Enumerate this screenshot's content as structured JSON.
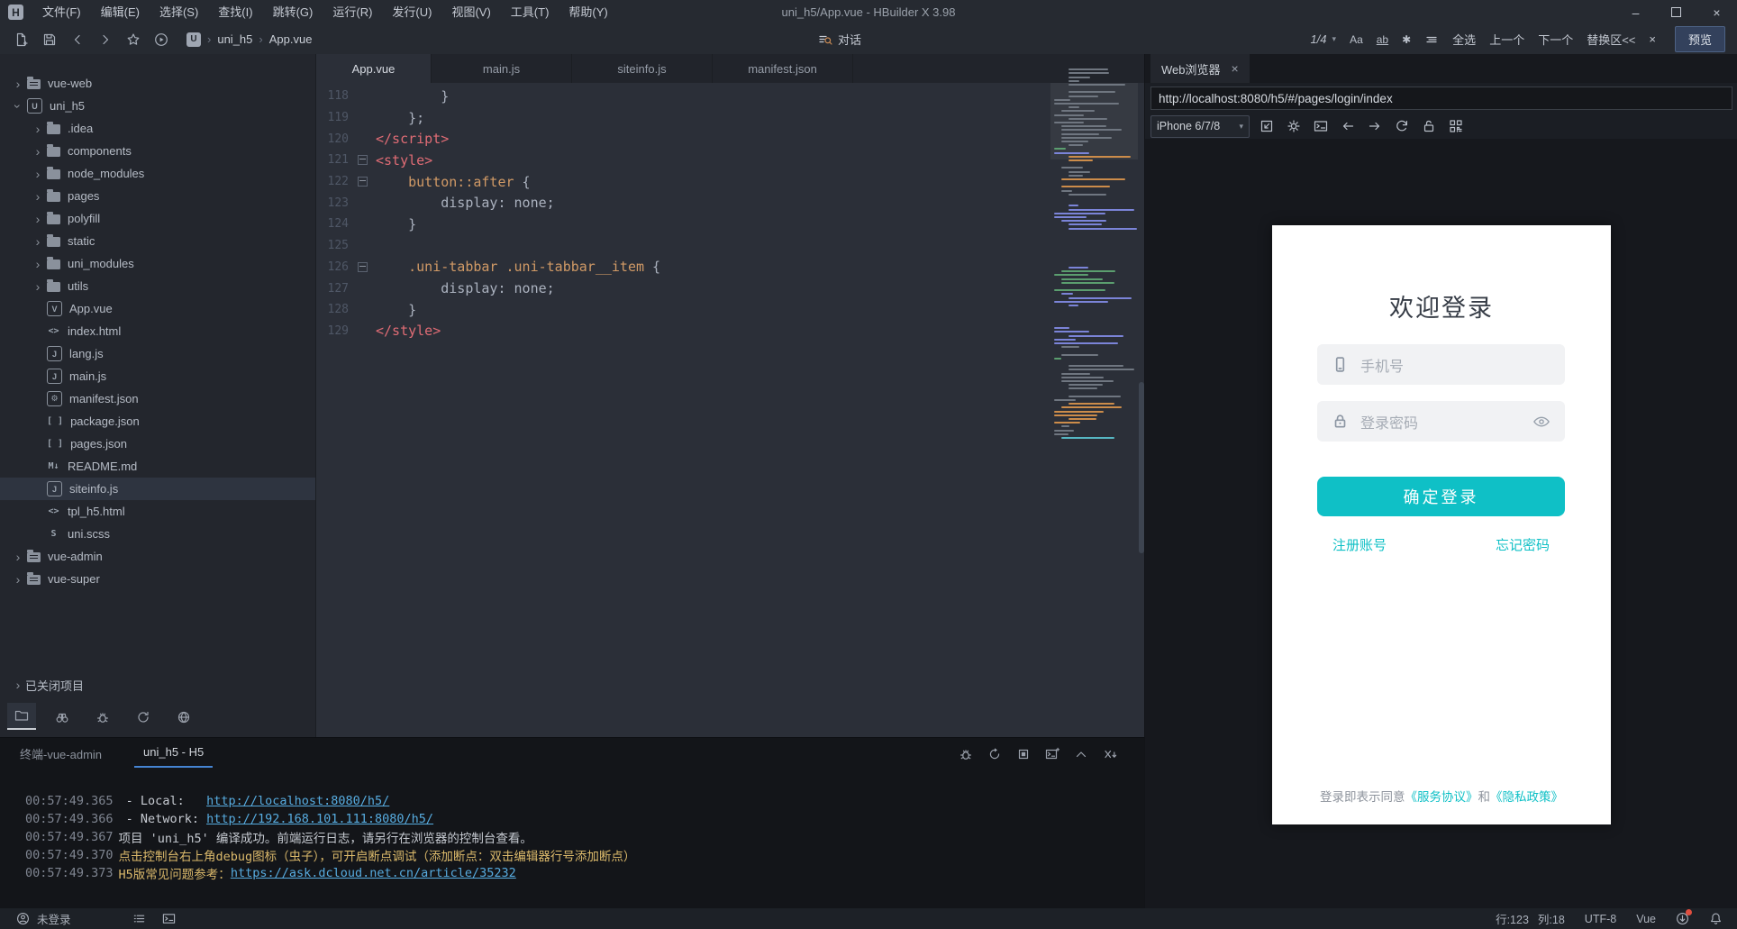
{
  "window": {
    "title": "uni_h5/App.vue - HBuilder X 3.98",
    "menus": [
      "文件(F)",
      "编辑(E)",
      "选择(S)",
      "查找(I)",
      "跳转(G)",
      "运行(R)",
      "发行(U)",
      "视图(V)",
      "工具(T)",
      "帮助(Y)"
    ]
  },
  "toolbar": {
    "breadcrumb": {
      "project": "uni_h5",
      "file": "App.vue"
    },
    "chat_label": "对话",
    "find": {
      "counter": "1/4",
      "select_all": "全选",
      "prev": "上一个",
      "next": "下一个",
      "replace": "替换区<<",
      "preview": "预览"
    }
  },
  "sidebar": {
    "closed_projects": "已关闭项目",
    "tree": [
      {
        "label": "vue-web",
        "depth": 0,
        "icon": "project-folder",
        "expand": "closed"
      },
      {
        "label": "uni_h5",
        "depth": 0,
        "icon": "uni",
        "expand": "open"
      },
      {
        "label": ".idea",
        "depth": 1,
        "icon": "folder",
        "expand": "closed"
      },
      {
        "label": "components",
        "depth": 1,
        "icon": "folder",
        "expand": "closed"
      },
      {
        "label": "node_modules",
        "depth": 1,
        "icon": "folder",
        "expand": "closed"
      },
      {
        "label": "pages",
        "depth": 1,
        "icon": "folder",
        "expand": "closed"
      },
      {
        "label": "polyfill",
        "depth": 1,
        "icon": "folder",
        "expand": "closed"
      },
      {
        "label": "static",
        "depth": 1,
        "icon": "folder",
        "expand": "closed"
      },
      {
        "label": "uni_modules",
        "depth": 1,
        "icon": "folder",
        "expand": "closed"
      },
      {
        "label": "utils",
        "depth": 1,
        "icon": "folder",
        "expand": "closed"
      },
      {
        "label": "App.vue",
        "depth": 1,
        "icon": "vue"
      },
      {
        "label": "index.html",
        "depth": 1,
        "icon": "html"
      },
      {
        "label": "lang.js",
        "depth": 1,
        "icon": "js"
      },
      {
        "label": "main.js",
        "depth": 1,
        "icon": "js"
      },
      {
        "label": "manifest.json",
        "depth": 1,
        "icon": "gearjson"
      },
      {
        "label": "package.json",
        "depth": 1,
        "icon": "json"
      },
      {
        "label": "pages.json",
        "depth": 1,
        "icon": "json"
      },
      {
        "label": "README.md",
        "depth": 1,
        "icon": "md"
      },
      {
        "label": "siteinfo.js",
        "depth": 1,
        "icon": "js",
        "selected": true
      },
      {
        "label": "tpl_h5.html",
        "depth": 1,
        "icon": "html"
      },
      {
        "label": "uni.scss",
        "depth": 1,
        "icon": "scss"
      },
      {
        "label": "vue-admin",
        "depth": 0,
        "icon": "project-folder",
        "expand": "closed"
      },
      {
        "label": "vue-super",
        "depth": 0,
        "icon": "project-folder",
        "expand": "closed"
      }
    ]
  },
  "editor": {
    "tabs": [
      {
        "label": "App.vue",
        "active": true
      },
      {
        "label": "main.js",
        "active": false
      },
      {
        "label": "siteinfo.js",
        "active": false
      },
      {
        "label": "manifest.json",
        "active": false
      }
    ],
    "code": [
      {
        "num": 118,
        "fold": false,
        "segments": [
          {
            "t": "        }",
            "c": "plain"
          }
        ]
      },
      {
        "num": 119,
        "fold": false,
        "segments": [
          {
            "t": "    };",
            "c": "plain"
          }
        ]
      },
      {
        "num": 120,
        "fold": false,
        "segments": [
          {
            "t": "</script>",
            "c": "tag"
          }
        ]
      },
      {
        "num": 121,
        "fold": true,
        "segments": [
          {
            "t": "<style>",
            "c": "tag"
          }
        ]
      },
      {
        "num": 122,
        "fold": true,
        "segments": [
          {
            "t": "    ",
            "c": "plain"
          },
          {
            "t": "button::after",
            "c": "sel"
          },
          {
            "t": " {",
            "c": "plain"
          }
        ]
      },
      {
        "num": 123,
        "fold": false,
        "segments": [
          {
            "t": "        display: none;",
            "c": "plain"
          }
        ]
      },
      {
        "num": 124,
        "fold": false,
        "segments": [
          {
            "t": "    }",
            "c": "plain"
          }
        ]
      },
      {
        "num": 125,
        "fold": false,
        "segments": []
      },
      {
        "num": 126,
        "fold": true,
        "segments": [
          {
            "t": "    ",
            "c": "plain"
          },
          {
            "t": ".uni-tabbar .uni-tabbar__item",
            "c": "sel"
          },
          {
            "t": " {",
            "c": "plain"
          }
        ]
      },
      {
        "num": 127,
        "fold": false,
        "segments": [
          {
            "t": "        display: none;",
            "c": "plain"
          }
        ]
      },
      {
        "num": 128,
        "fold": false,
        "segments": [
          {
            "t": "    }",
            "c": "plain"
          }
        ]
      },
      {
        "num": 129,
        "fold": false,
        "segments": [
          {
            "t": "</style>",
            "c": "tag"
          }
        ]
      }
    ]
  },
  "console": {
    "tabs": [
      {
        "label": "终端-vue-admin",
        "active": false
      },
      {
        "label": "uni_h5 - H5",
        "active": true
      }
    ],
    "lines": [
      {
        "time": "00:57:49.365",
        "segments": [
          {
            "t": " - Local:   ",
            "c": "plain"
          },
          {
            "t": "http://localhost:8080/h5/",
            "c": "link"
          }
        ]
      },
      {
        "time": "00:57:49.366",
        "segments": [
          {
            "t": " - Network: ",
            "c": "plain"
          },
          {
            "t": "http://192.168.101.111:8080/h5/",
            "c": "link"
          }
        ]
      },
      {
        "time": "00:57:49.367",
        "segments": [
          {
            "t": "项目 'uni_h5' 编译成功。前端运行日志，请另行在浏览器的控制台查看。",
            "c": "plain"
          }
        ]
      },
      {
        "time": "00:57:49.370",
        "segments": [
          {
            "t": "点击控制台右上角debug图标（虫子），可开启断点调试（添加断点：双击编辑器行号添加断点）",
            "c": "warn"
          }
        ]
      },
      {
        "time": "00:57:49.373",
        "segments": [
          {
            "t": "H5版常见问题参考：",
            "c": "warn"
          },
          {
            "t": "https://ask.dcloud.net.cn/article/35232",
            "c": "link"
          }
        ]
      }
    ]
  },
  "browser": {
    "tab_label": "Web浏览器",
    "url": "http://localhost:8080/h5/#/pages/login/index",
    "device": "iPhone 6/7/8",
    "accent": "#0fc0c6",
    "login": {
      "title": "欢迎登录",
      "phone_placeholder": "手机号",
      "password_placeholder": "登录密码",
      "submit_label": "确定登录",
      "register_label": "注册账号",
      "forgot_label": "忘记密码",
      "agreement_prefix": "登录即表示同意",
      "service_link": "《服务协议》",
      "and_text": "和",
      "privacy_link": "《隐私政策》"
    }
  },
  "statusbar": {
    "user": "未登录",
    "line": "行:123",
    "col": "列:18",
    "encoding": "UTF-8",
    "language": "Vue"
  }
}
